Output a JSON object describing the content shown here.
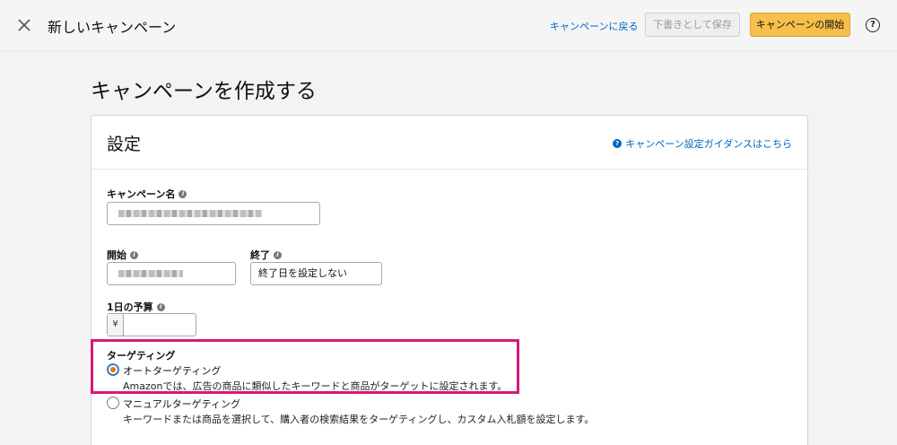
{
  "header": {
    "title": "新しいキャンペーン",
    "back_link": "キャンペーンに戻る",
    "save_draft": "下書きとして保存",
    "start_campaign": "キャンペーンの開始",
    "help_glyph": "?"
  },
  "page": {
    "title": "キャンペーンを作成する"
  },
  "settings": {
    "title": "設定",
    "guide_link": "キャンペーン設定ガイダンスはこちら",
    "campaign_name_label": "キャンペーン名",
    "start_label": "開始",
    "end_label": "終了",
    "end_value": "終了日を設定しない",
    "budget_label": "1日の予算",
    "currency": "¥",
    "targeting_label": "ターゲティング",
    "options": [
      {
        "label": "オートターゲティング",
        "desc": "Amazonでは、広告の商品に類似したキーワードと商品がターゲットに設定されます。",
        "selected": true
      },
      {
        "label": "マニュアルターゲティング",
        "desc": "キーワードまたは商品を選択して、購入者の検索結果をターゲティングし、カスタム入札額を設定します。",
        "selected": false
      }
    ]
  },
  "colors": {
    "link": "#0066c0",
    "primary_button": "#f7c04a",
    "highlight_frame": "#d6197f",
    "radio_dot": "#e47911"
  },
  "icons": {
    "close": "close-icon",
    "help": "help-circle-icon",
    "info": "info-icon"
  }
}
